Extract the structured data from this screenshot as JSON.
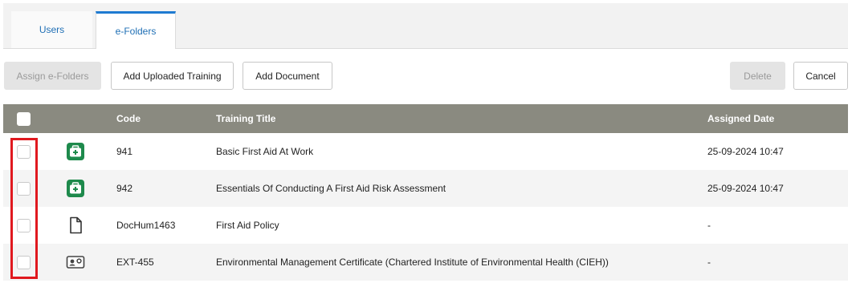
{
  "tabs": [
    {
      "label": "Users"
    },
    {
      "label": "e-Folders",
      "active": true
    }
  ],
  "toolbar": {
    "assign_label": "Assign e-Folders",
    "add_uploaded_label": "Add Uploaded Training",
    "add_document_label": "Add Document",
    "delete_label": "Delete",
    "cancel_label": "Cancel"
  },
  "table": {
    "headers": {
      "code": "Code",
      "title": "Training Title",
      "assigned": "Assigned Date"
    },
    "rows": [
      {
        "icon": "first-aid-kit-icon",
        "code": "941",
        "title": "Basic First Aid At Work",
        "assigned": "25-09-2024 10:47"
      },
      {
        "icon": "first-aid-kit-icon",
        "code": "942",
        "title": "Essentials Of Conducting A First Aid Risk Assessment",
        "assigned": "25-09-2024 10:47"
      },
      {
        "icon": "document-icon",
        "code": "DocHum1463",
        "title": "First Aid Policy",
        "assigned": "-"
      },
      {
        "icon": "certificate-icon",
        "code": "EXT-455",
        "title": "Environmental Management Certificate (Chartered Institute of Environmental Health (CIEH))",
        "assigned": "-"
      }
    ]
  },
  "colors": {
    "header_bg": "#8a8a80",
    "accent_tab": "#1f7bd1",
    "first_aid_green": "#1e8a4c",
    "highlight_red": "#e0191f"
  }
}
